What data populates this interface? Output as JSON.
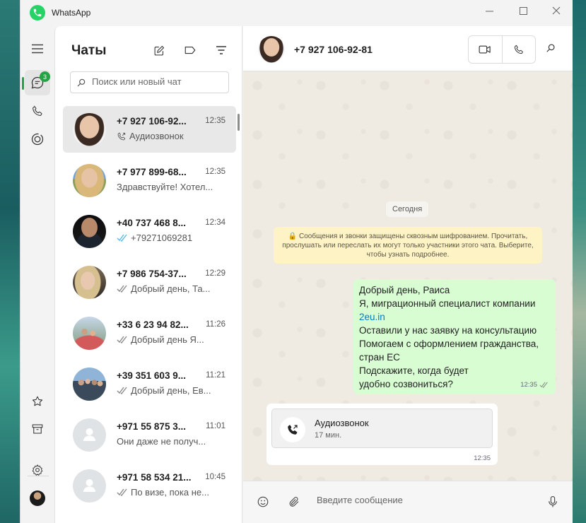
{
  "window": {
    "title": "WhatsApp",
    "min_label": "—",
    "max_label": "☐",
    "close_label": "✕"
  },
  "rail": {
    "unread_badge": "3"
  },
  "chat_list": {
    "title": "Чаты",
    "search_placeholder": "Поиск или новый чат",
    "items": [
      {
        "name": "+7 927 106-92...",
        "time": "12:35",
        "preview": "Аудиозвонок",
        "status": "call-out",
        "avatar": "woman-dark-hair"
      },
      {
        "name": "+7 977 899-68...",
        "time": "12:35",
        "preview": "Здравствуйте! Хотел...",
        "status": "none",
        "avatar": "woman-blonde"
      },
      {
        "name": "+40 737 468 8...",
        "time": "12:34",
        "preview": "+79271069281",
        "status": "read-blue",
        "avatar": "man-suit"
      },
      {
        "name": "+7 986 754-37...",
        "time": "12:29",
        "preview": "Добрый день, Та...",
        "status": "read-grey",
        "avatar": "woman-blonde-2"
      },
      {
        "name": "+33 6 23 94 82...",
        "time": "11:26",
        "preview": "Добрый день Я...",
        "status": "read-grey",
        "avatar": "group-outdoor"
      },
      {
        "name": "+39 351 603 9...",
        "time": "11:21",
        "preview": "Добрый день, Ев...",
        "status": "read-grey",
        "avatar": "group-people"
      },
      {
        "name": "+971 55 875 3...",
        "time": "11:01",
        "preview": "Они даже не получ...",
        "status": "none",
        "avatar": "default"
      },
      {
        "name": "+971 58 534 21...",
        "time": "10:45",
        "preview": "По визе, пока не...",
        "status": "read-grey",
        "avatar": "default"
      }
    ]
  },
  "conversation": {
    "contact": "+7 927 106-92-81",
    "date_chip": "Сегодня",
    "encryption_notice": "🔒 Сообщения и звонки защищены сквозным шифрованием. Прочитать, прослушать или переслать их могут только участники этого чата. Выберите, чтобы узнать подробнее.",
    "outgoing": {
      "lines": [
        "Добрый день, Раиса",
        "Я, миграционный специалист компании",
        "2eu.in",
        "Оставили у нас заявку на консультацию",
        "Помогаем с оформлением гражданства,",
        "стран ЕС",
        "Подскажите, когда будет",
        "удобно созвониться?"
      ],
      "time": "12:35"
    },
    "call_message": {
      "title": "Аудиозвонок",
      "duration": "17 мин.",
      "time": "12:35"
    },
    "composer_placeholder": "Введите сообщение"
  },
  "colors": {
    "accent": "#25d366",
    "badge": "#25a244",
    "outgoing_bubble": "#d9fdd3",
    "read_blue": "#53bdeb",
    "link": "#027eb5"
  }
}
